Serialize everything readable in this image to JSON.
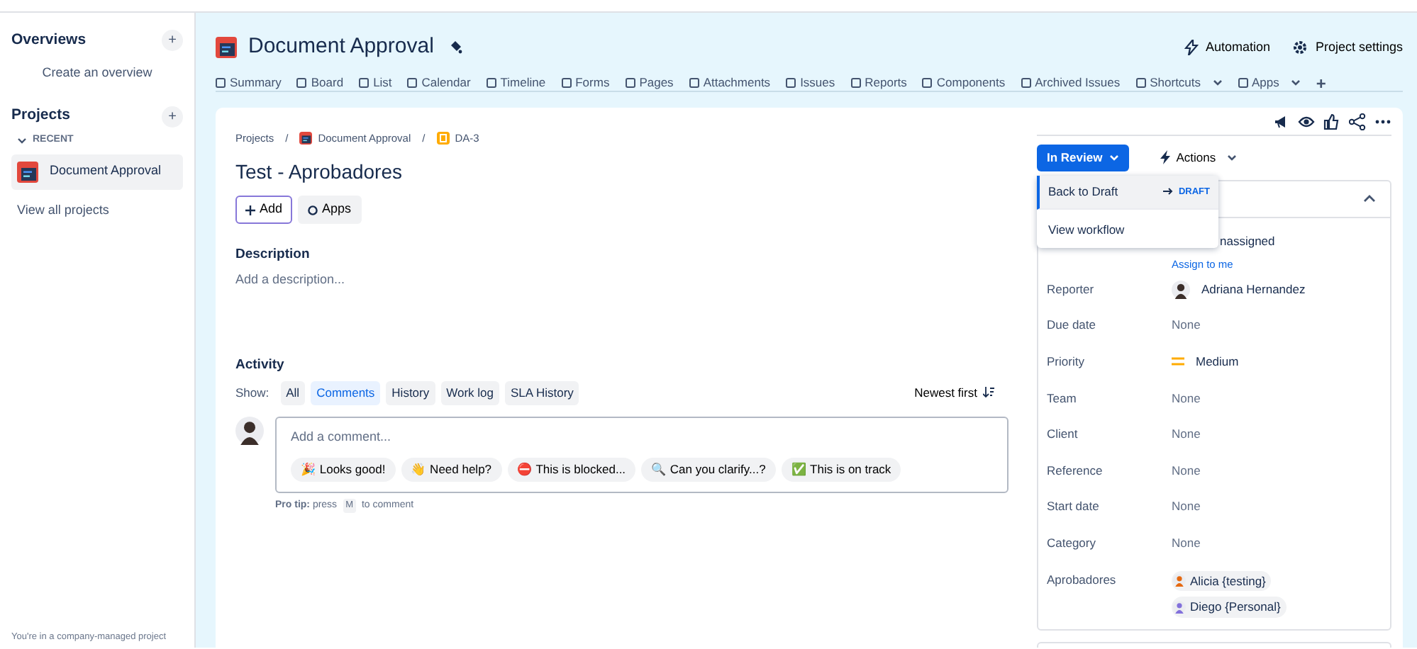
{
  "sidebar": {
    "overviews": {
      "title": "Overviews",
      "add": "+",
      "link": "Create an overview"
    },
    "projects": {
      "title": "Projects",
      "add": "+",
      "group": "RECENT",
      "expanded": true,
      "items": [
        {
          "label": "Document Approval",
          "selected": true
        }
      ],
      "link": "View all projects"
    },
    "footer": "You're in a company-managed project"
  },
  "header": {
    "title": "Document Approval",
    "actions": [
      "Automation",
      "Project settings"
    ],
    "tabs": [
      {
        "label": "Summary",
        "dropdown": false
      },
      {
        "label": "Board",
        "dropdown": false
      },
      {
        "label": "List",
        "dropdown": false
      },
      {
        "label": "Calendar",
        "dropdown": false
      },
      {
        "label": "Timeline",
        "dropdown": false
      },
      {
        "label": "Forms",
        "dropdown": false
      },
      {
        "label": "Pages",
        "dropdown": false
      },
      {
        "label": "Attachments",
        "dropdown": false
      },
      {
        "label": "Issues",
        "dropdown": false
      },
      {
        "label": "Reports",
        "dropdown": false
      },
      {
        "label": "Components",
        "dropdown": false
      },
      {
        "label": "Archived Issues",
        "dropdown": false
      },
      {
        "label": "Shortcuts",
        "dropdown": true
      },
      {
        "label": "Apps",
        "dropdown": true
      }
    ],
    "add_tab": "+"
  },
  "issue": {
    "breadcrumbs": [
      "Projects",
      "Document Approval",
      "DA-3"
    ],
    "breadcrumb_separator": "/",
    "title": "Test - Aprobadores",
    "buttons": [
      {
        "label": "Add",
        "focused": true
      },
      {
        "label": "Apps",
        "focused": false
      }
    ],
    "description": {
      "heading": "Description",
      "placeholder": "Add a description..."
    },
    "activity": {
      "heading": "Activity",
      "show_label": "Show:",
      "filters": [
        {
          "label": "All",
          "selected": false
        },
        {
          "label": "Comments",
          "selected": true
        },
        {
          "label": "History",
          "selected": false
        },
        {
          "label": "Work log",
          "selected": false
        },
        {
          "label": "SLA History",
          "selected": false
        }
      ],
      "sort": "Newest first",
      "comment": {
        "placeholder": "Add a comment...",
        "chips": [
          "🎉 Looks good!",
          "👋 Need help?",
          "⛔ This is blocked...",
          "🔍 Can you clarify...?",
          "✅ This is on track"
        ]
      },
      "pro_tip": "**Pro tip:** press",
      "key": "M",
      "pro_tip_end": "to comment"
    }
  },
  "status": {
    "label": "In Review",
    "actions": "Actions",
    "menu": [
      {
        "label": "Back to Draft",
        "target": "DRAFT",
        "selected": true
      },
      {
        "label": "View workflow",
        "selected": false
      }
    ]
  },
  "details": {
    "expanded": true,
    "fields": [
      {
        "kind": "assignee",
        "value": "nassigned",
        "link": "Assign to me"
      },
      {
        "kind": "user",
        "label": "Reporter",
        "value": "Adriana Hernandez"
      },
      {
        "kind": "text",
        "label": "Due date",
        "value": "None"
      },
      {
        "kind": "priority",
        "label": "Priority",
        "value": "Medium",
        "color": "#ffab00"
      },
      {
        "kind": "text",
        "label": "Team",
        "value": "None"
      },
      {
        "kind": "text",
        "label": "Client",
        "value": "None"
      },
      {
        "kind": "text",
        "label": "Reference",
        "value": "None"
      },
      {
        "kind": "text",
        "label": "Start date",
        "value": "None"
      },
      {
        "kind": "text",
        "label": "Category",
        "value": "None"
      },
      {
        "kind": "users",
        "label": "Aprobadores",
        "values": [
          "Alicia {testing}",
          "Diego {Personal}"
        ]
      }
    ]
  }
}
